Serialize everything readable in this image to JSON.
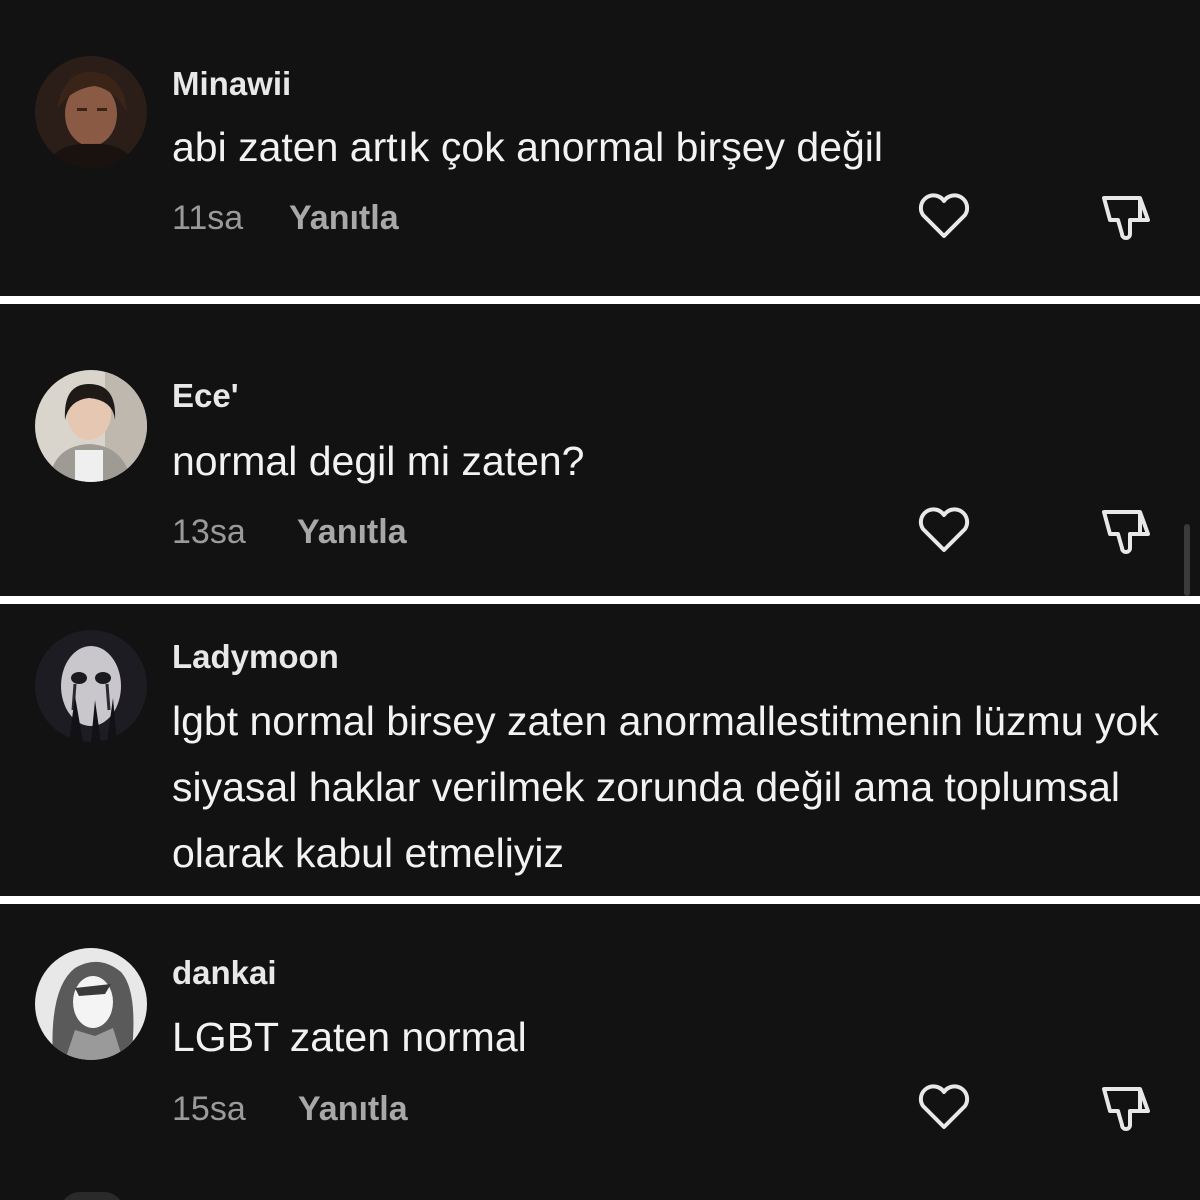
{
  "comments": [
    {
      "username": "Minawii",
      "text": "abi zaten artık çok anormal birşey değil",
      "time": "11sa",
      "reply_label": "Yanıtla",
      "avatar_icon": "avatar-dark-haired-man"
    },
    {
      "username": "Ece'",
      "text": "normal degil mi zaten?",
      "time": "13sa",
      "reply_label": "Yanıtla",
      "avatar_icon": "avatar-girl-photo"
    },
    {
      "username": "Ladymoon",
      "text": "lgbt normal birsey zaten anormallestitmenin lüzmu yok siyasal haklar verilmek zorunda değil ama toplumsal olarak kabul etmeliyiz",
      "avatar_icon": "avatar-dark-face"
    },
    {
      "username": "dankai",
      "text": "LGBT zaten normal",
      "time": "15sa",
      "reply_label": "Yanıtla",
      "avatar_icon": "avatar-manga-drawing"
    }
  ],
  "icons": {
    "like": "heart-outline-icon",
    "dislike": "thumbs-down-outline-icon"
  },
  "colors": {
    "background": "#121212",
    "separator": "#ffffff",
    "username": "#e8e8e8",
    "text": "#f2f2f2",
    "meta": "#9a9a9a"
  }
}
